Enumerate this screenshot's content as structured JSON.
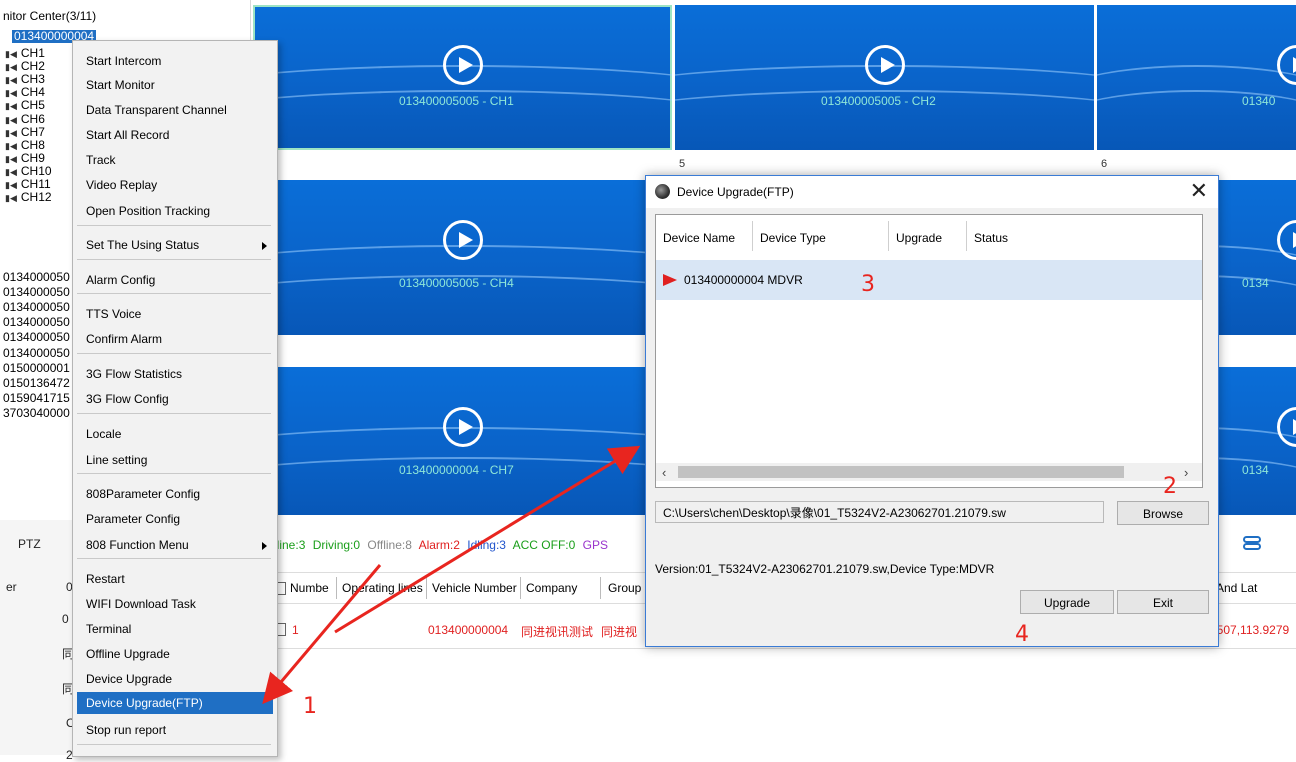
{
  "tree": {
    "root": "nitor Center(3/11)",
    "selected": "013400000004",
    "channels": [
      "CH1",
      "CH2",
      "CH3",
      "CH4",
      "CH5",
      "CH6",
      "CH7",
      "CH8",
      "CH9",
      "CH10",
      "CH11",
      "CH12"
    ],
    "devices": [
      "0134000050",
      "0134000050",
      "0134000050",
      "0134000050",
      "0134000050",
      "0134000050",
      "0150000001",
      "0150136472",
      "0159041715",
      "3703040000"
    ]
  },
  "video": {
    "cells": [
      {
        "caption": "013400005005 - CH1"
      },
      {
        "caption": "013400005005 - CH2"
      },
      {
        "caption": "01340"
      },
      {
        "caption": "013400005005 - CH4"
      },
      {
        "caption": "0134"
      },
      {
        "caption": "013400000004 - CH7"
      },
      {
        "caption": "0134"
      }
    ],
    "numbers": [
      "5",
      "6"
    ]
  },
  "context_menu": {
    "items": [
      "Start Intercom",
      "Start Monitor",
      "Data Transparent Channel",
      "Start All Record",
      "Track",
      "Video Replay",
      "Open Position Tracking",
      "Set The Using Status",
      "Alarm Config",
      "TTS Voice",
      "Confirm Alarm",
      "3G Flow Statistics",
      "3G Flow Config",
      "Locale",
      "Line setting",
      "808Parameter Config",
      "Parameter Config",
      "808 Function Menu",
      "Restart",
      "WIFI Download Task",
      "Terminal",
      "Offline Upgrade",
      "Device Upgrade",
      "Device Upgrade(FTP)",
      "Stop run report"
    ]
  },
  "status": {
    "online": "nline:3",
    "driving": "Driving:0",
    "offline": "Offline:8",
    "alarm": "Alarm:2",
    "idling": "Idling:3",
    "acc": "ACC OFF:0",
    "gps": "GPS",
    "colors": {
      "online": "#1a9e1a",
      "driving": "#1a9e1a",
      "offline": "#888888",
      "alarm": "#e02020",
      "idling": "#2255cc",
      "acc": "#1a9e1a",
      "gps": "#9933cc"
    }
  },
  "left_panel": {
    "ptz": "PTZ",
    "er": "er",
    "c0": "0",
    "c1": "0",
    "c2": "同",
    "c3": "同",
    "c4": "O",
    "c5": "2"
  },
  "table": {
    "headers": [
      "Numbe",
      "Operating lines",
      "Vehicle Number",
      "Company",
      "Group",
      "And Lat"
    ],
    "row1": {
      "num": "1",
      "vehicle": "013400000004",
      "company": "同进视讯测试",
      "group": "同进视",
      "latlng": "2507,113.9279"
    }
  },
  "dialog": {
    "title": "Device Upgrade(FTP)",
    "columns": [
      "Device Name",
      "Device Type",
      "Upgrade",
      "Status"
    ],
    "device_row": "013400000004 MDVR",
    "path_value": "C:\\Users\\chen\\Desktop\\录像\\01_T5324V2-A23062701.21079.sw",
    "browse": "Browse",
    "version_text": "Version:01_T5324V2-A23062701.21079.sw,Device Type:MDVR",
    "upgrade": "Upgrade",
    "exit": "Exit"
  },
  "annotations": {
    "n1": "1",
    "n2": "2",
    "n3": "3",
    "n4": "4"
  }
}
